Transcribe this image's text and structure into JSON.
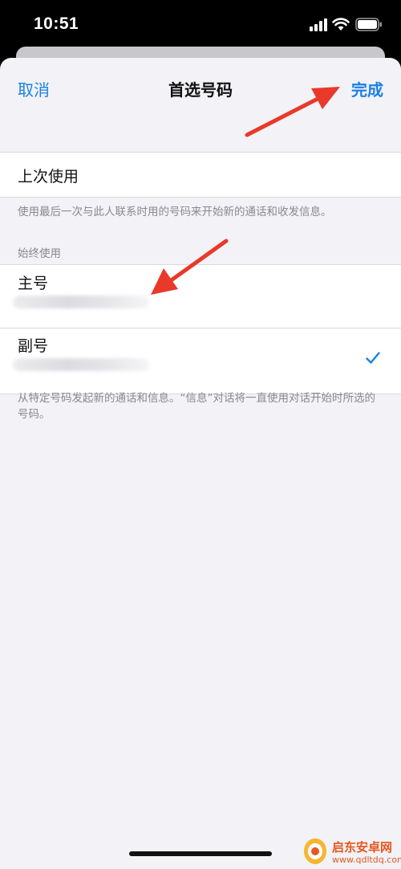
{
  "status_bar": {
    "time": "10:51",
    "signal_icon": "signal-bars-icon",
    "wifi_icon": "wifi-icon",
    "battery_icon": "battery-icon"
  },
  "nav": {
    "cancel_label": "取消",
    "title": "首选号码",
    "done_label": "完成"
  },
  "last_used": {
    "label": "上次使用",
    "footnote": "使用最后一次与此人联系时用的号码来开始新的通话和收发信息。"
  },
  "always_use": {
    "header": "始终使用",
    "items": [
      {
        "label": "主号",
        "selected": false
      },
      {
        "label": "副号",
        "selected": true
      }
    ],
    "footnote": "从特定号码发起新的通话和信息。“信息”对话将一直使用对话开始时所选的号码。"
  },
  "watermark": {
    "name": "启东安卓网",
    "url": "www.qdltdq.com"
  },
  "colors": {
    "accent": "#1a80e6",
    "arrow": "#e8392a",
    "background": "#f2f2f7"
  }
}
